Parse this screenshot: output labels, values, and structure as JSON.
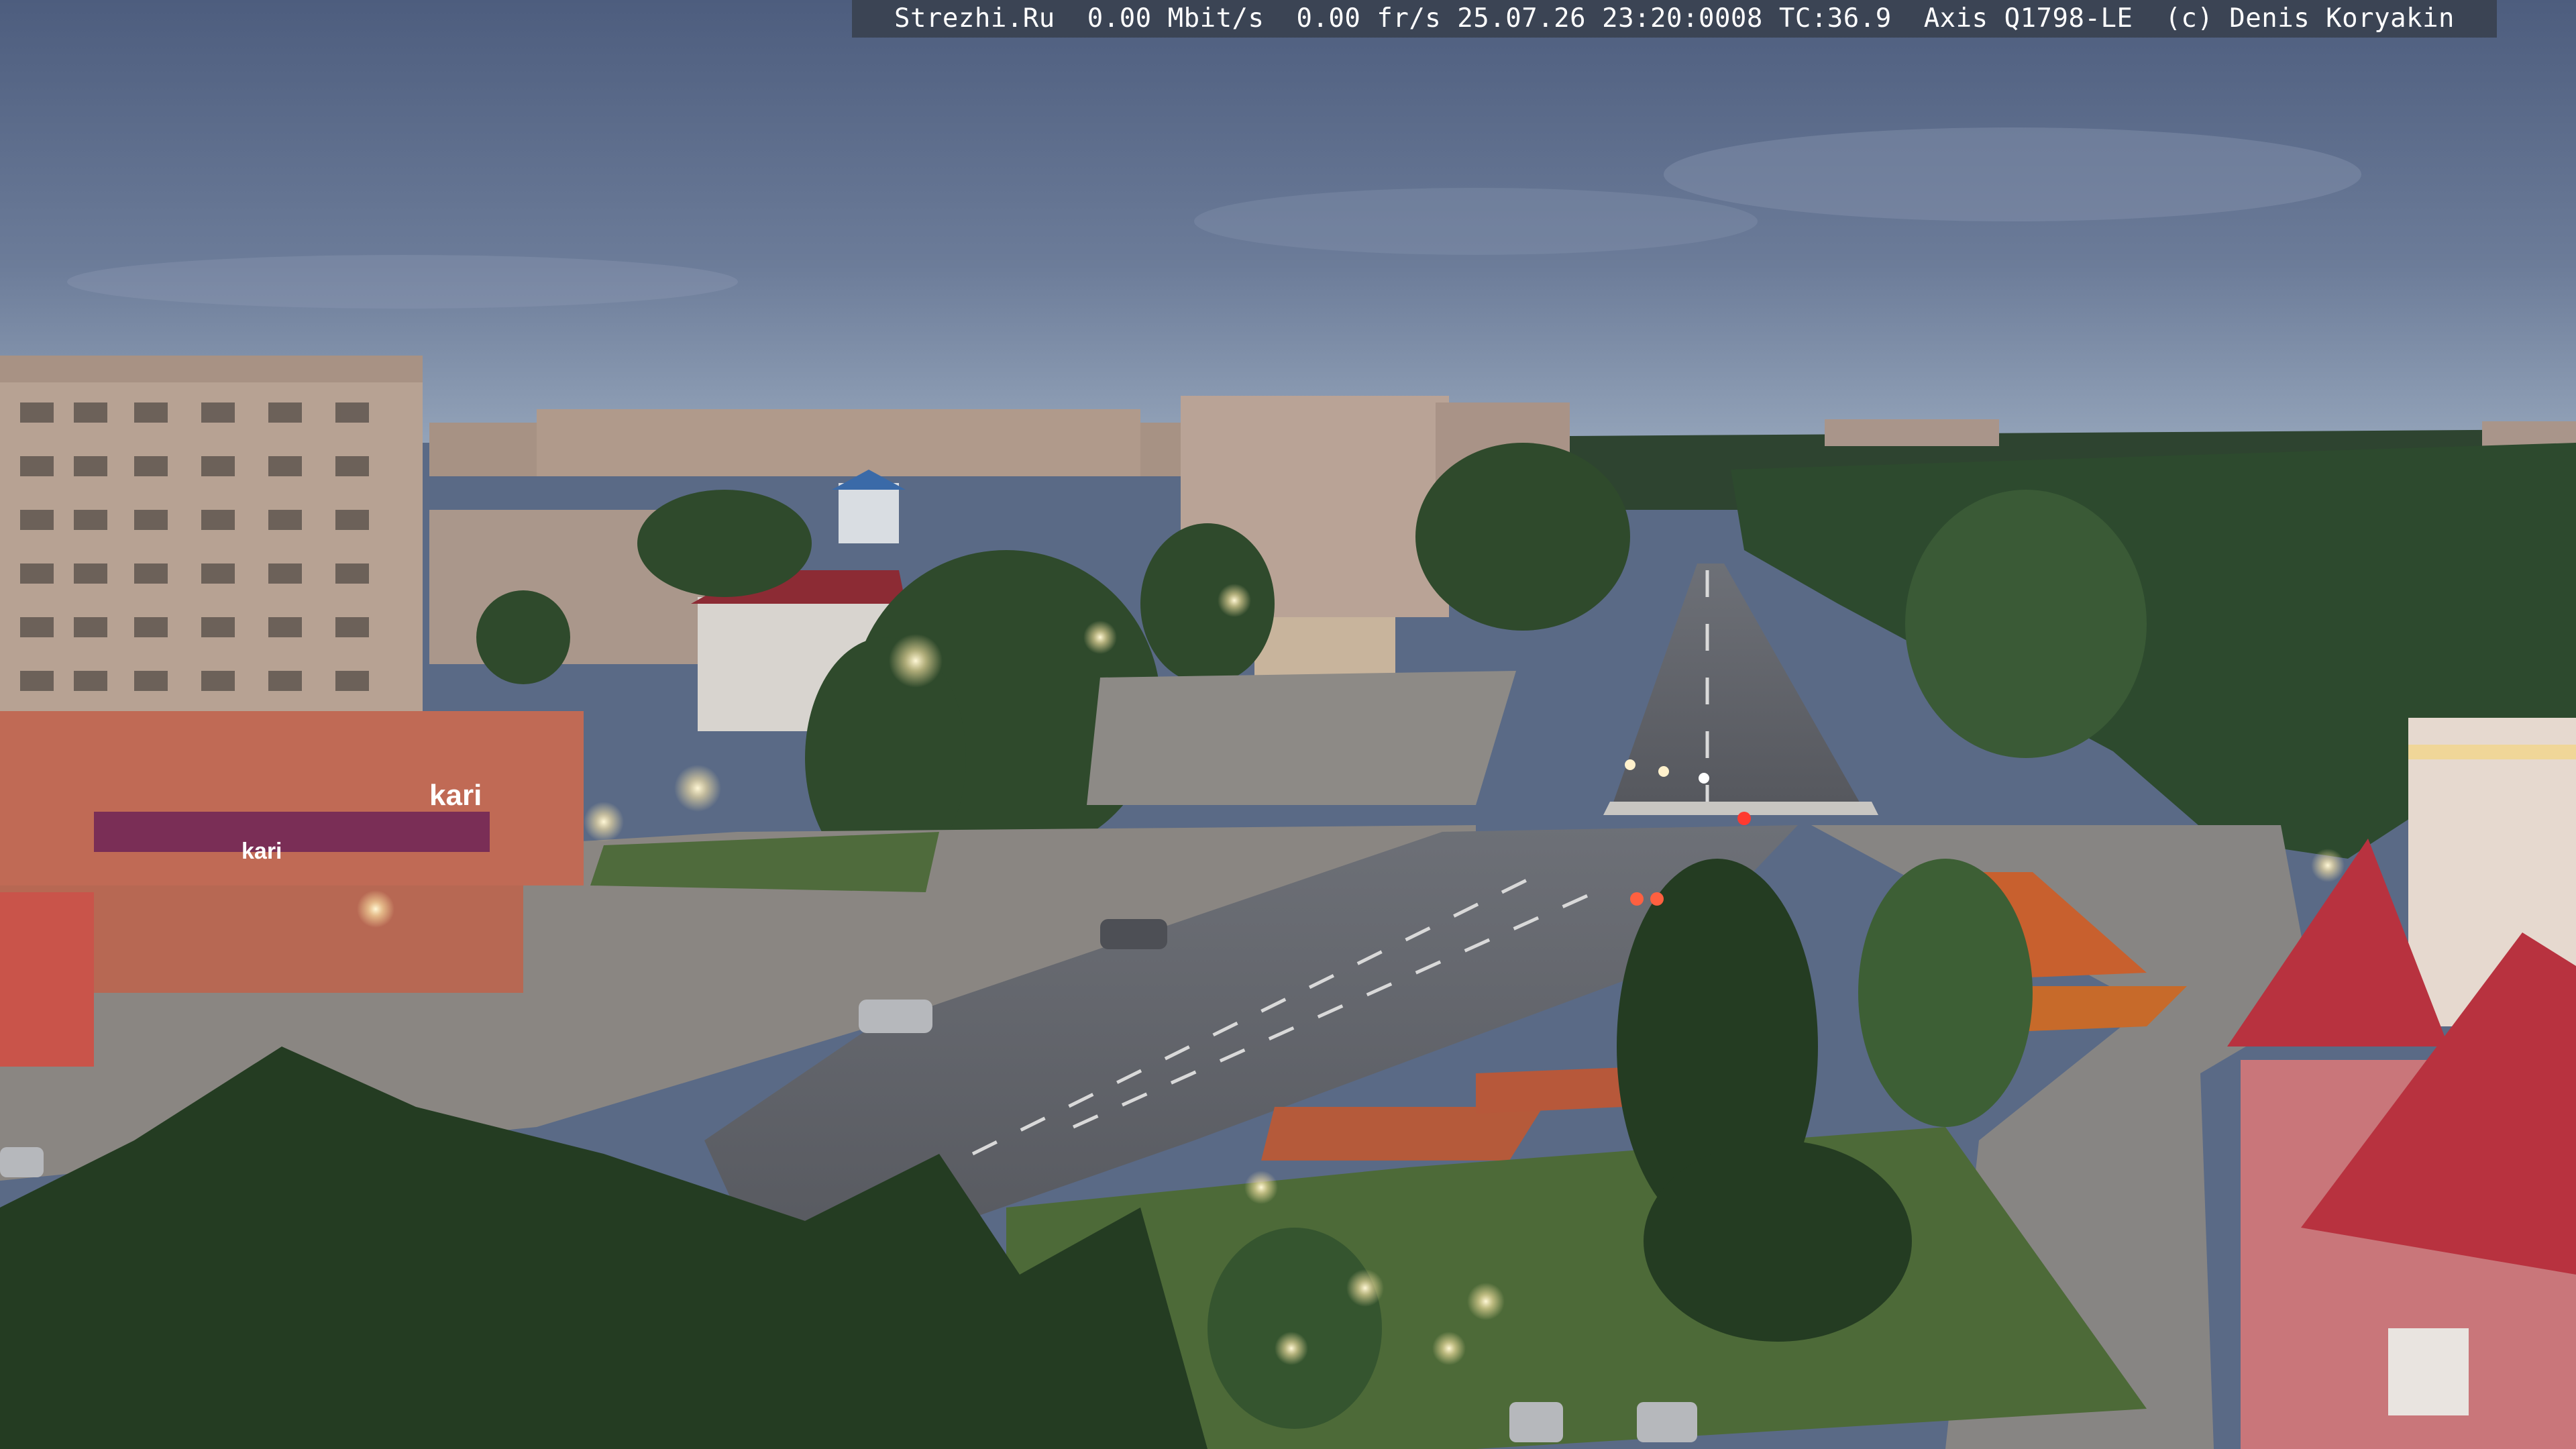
{
  "overlay": {
    "text": "Strezhi.Ru  0.00 Mbit/s  0.00 fr/s 25.07.26 23:20:0008 TC:36.9  Axis Q1798-LE  (c) Denis Koryakin"
  },
  "signs": {
    "store_name": "kari",
    "store_name_small": "kari"
  },
  "colors": {
    "sky_top": "#4d5d7e",
    "sky_bottom": "#93a3b9",
    "trees": "#2f4a2c",
    "road": "#5e6066",
    "plaza": "#8a8682",
    "building_tan": "#b7a293",
    "building_red": "#c06a55",
    "roof_red": "#b8323f",
    "flowers": "#c8602e"
  }
}
